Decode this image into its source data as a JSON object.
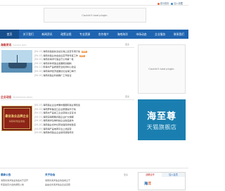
{
  "topbar": {
    "links": [
      {
        "label": "设为首页",
        "icon": "home-icon"
      },
      {
        "label": "加入收藏",
        "icon": "star-icon"
      }
    ]
  },
  "banner": {
    "placeholder": "Couldn't load plugin."
  },
  "nav": {
    "items": [
      "首页",
      "关于我们",
      "新闻资讯",
      "政策法规",
      "专业资源",
      "合作推介",
      "海南海洋",
      "市场动态",
      "企业服务",
      "联系我们"
    ]
  },
  "section1": {
    "title": "海南资讯",
    "sub": "HAINAN INFO",
    "more": "更多",
    "rows": [
      {
        "date": "[04-13]",
        "text": "海南省渔政执法总队海上巡查专项行动",
        "tag": "NEW"
      },
      {
        "date": "[04-13]",
        "text": "海南省渔业协会会议召开暨年度工作",
        "tag": "NEW"
      },
      {
        "date": "[04-12]",
        "text": "海南省海洋与渔业厅公布第一批",
        "tag": ""
      },
      {
        "date": "[04-12]",
        "text": "海南省休闲渔业发展规划编制",
        "tag": ""
      },
      {
        "date": "[04-11]",
        "text": "南海水产品质量安全检测中心建设",
        "tag": ""
      },
      {
        "date": "[04-10]",
        "text": "海南海洋经济发展论坛在海口举行",
        "tag": ""
      },
      {
        "date": "[04-10]",
        "text": "海南省渔业科技推广工作会议",
        "tag": ""
      }
    ]
  },
  "ad1": {
    "placeholder": "Couldn't load plugin."
  },
  "section2": {
    "title": "企业动态",
    "sub": "ENTERPRISE NEWS",
    "more": "更多",
    "cert_line1": "最佳渔业品牌企业",
    "cert_line2": "海南海洋渔业协会",
    "rows": [
      {
        "date": "[04-13]",
        "text": "海南渔业企业参展中国国际渔业博览会"
      },
      {
        "date": "[04-13]",
        "text": "海南罗非鱼出口企业质量提升行动"
      },
      {
        "date": "[04-12]",
        "text": "海南水产品加工企业获得认证证书"
      },
      {
        "date": "[04-11]",
        "text": "海南深海网箱养殖企业扩大规模"
      },
      {
        "date": "[04-10]",
        "text": "海南海洋生物科技企业新品发布"
      },
      {
        "date": "[04-10]",
        "text": "海南渔业合作社带动渔民增收致富"
      },
      {
        "date": "[04-09]",
        "text": "海南海产品电商平台上线运营"
      },
      {
        "date": "[04-08]",
        "text": "海南休闲渔业企业接待游客增长"
      }
    ]
  },
  "brand": {
    "big": "海至尊",
    "small": "天猫旗舰店"
  },
  "footer": {
    "col1": {
      "title": "最新公告",
      "lines": [
        "海南省海洋渔业协会关于召开",
        "年度会员大会的通知公告"
      ]
    },
    "col2": {
      "title": "关于协会",
      "more": "更多",
      "lines": [
        "海南省海洋渔业协会成立于",
        "是由全省海洋渔业企业自愿"
      ]
    },
    "tabs": [
      "战略合作",
      "加入会员"
    ],
    "logo_part1": "海",
    "logo_part2": "洋"
  }
}
